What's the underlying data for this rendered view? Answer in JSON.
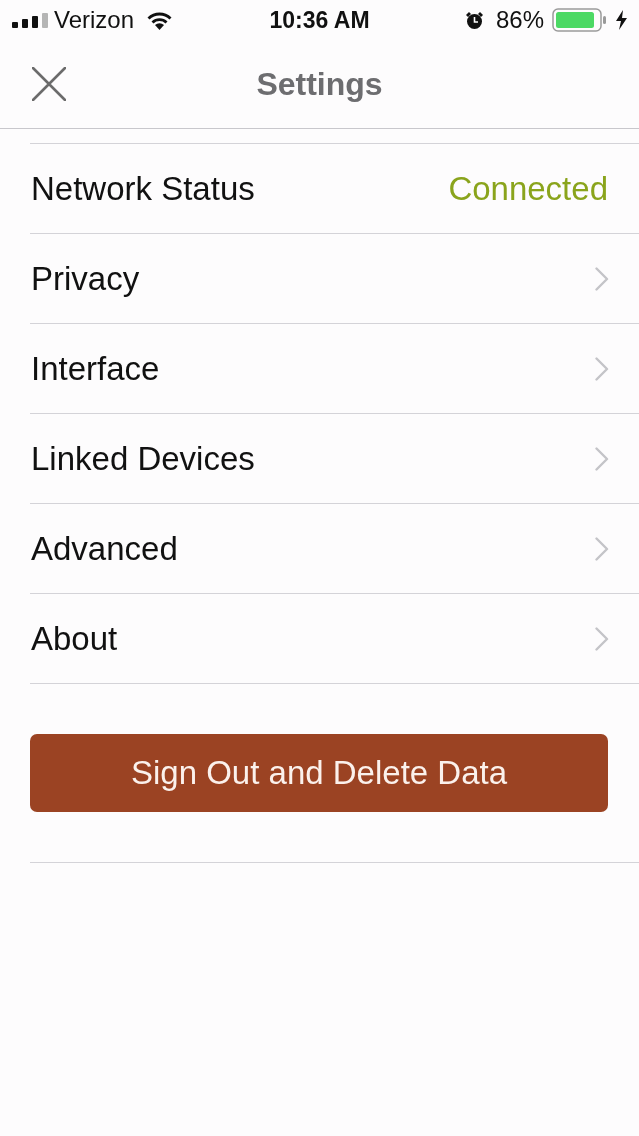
{
  "status_bar": {
    "carrier": "Verizon",
    "time": "10:36 AM",
    "battery": "86%"
  },
  "header": {
    "title": "Settings"
  },
  "rows": [
    {
      "kind": "value",
      "label": "Network Status",
      "value": "Connected"
    },
    {
      "kind": "link",
      "label": "Privacy"
    },
    {
      "kind": "link",
      "label": "Interface"
    },
    {
      "kind": "link",
      "label": "Linked Devices"
    },
    {
      "kind": "link",
      "label": "Advanced"
    },
    {
      "kind": "link",
      "label": "About"
    }
  ],
  "button": {
    "label": "Sign Out and Delete Data"
  }
}
